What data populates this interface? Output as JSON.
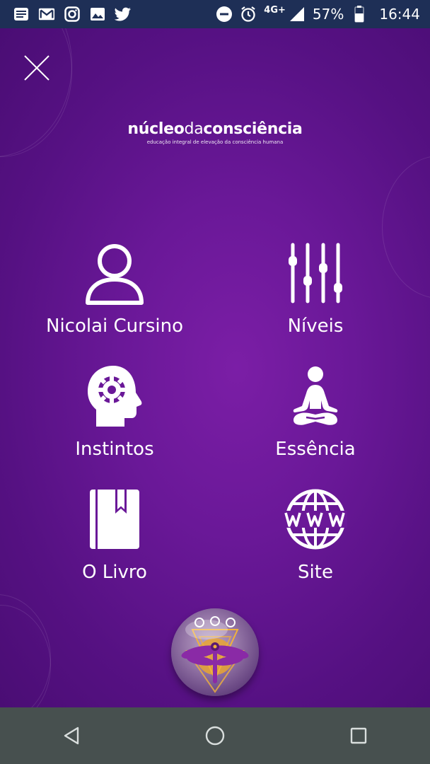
{
  "status_bar": {
    "network": "4G+",
    "battery": "57%",
    "time": "16:44"
  },
  "logo": {
    "part1": "núcleo",
    "part2": "da",
    "part3": "consciência",
    "tagline": "educação integral de elevação da consciência humana"
  },
  "menu": {
    "item1": "Nicolai Cursino",
    "item2": "Níveis",
    "item3": "Instintos",
    "item4": "Essência",
    "item5": "O Livro",
    "item6": "Site"
  },
  "icons": {
    "close": "close-icon",
    "person": "person-icon",
    "sliders": "sliders-icon",
    "head_gear": "head-gear-icon",
    "meditation": "meditation-icon",
    "book": "book-icon",
    "globe_www": "globe-www-icon"
  },
  "colors": {
    "status_bar": "#1e2f56",
    "background": "#6a1898",
    "nav_bar": "#47504f"
  }
}
